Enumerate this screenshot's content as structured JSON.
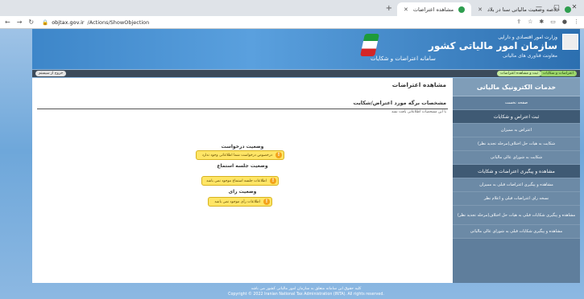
{
  "browser": {
    "tabs": [
      {
        "label": "خلاصه وضعیت مالیاتی سنا در بلاد",
        "active": false
      },
      {
        "label": "مشاهده اعتراضات",
        "active": true
      }
    ],
    "new_tab": "+",
    "url_host": "objtax.gov.ir",
    "url_path": "/Actions/ShowObjection"
  },
  "header": {
    "org_line1": "وزارت امور اقتصادی و دارایی",
    "org_name": "سازمان امور مالیاتی کشور",
    "org_line3": "معاونت فناوری های مالیاتی",
    "system_name": "سامانه اعتراضات و شکایات"
  },
  "navbar": {
    "btn_complaints": "اعتراضات و شکایات",
    "btn_view": "ثبت و مشاهده اعتراضات",
    "btn_logout": "خروج از سیستم"
  },
  "sidebar": {
    "brand": "خدمات الکترونیک مالیاتی",
    "items": [
      "صفحه نخست",
      "ثبت اعتراض و شکایات",
      "اعتراض به ممیزان",
      "شکایت به هیات حل اختلاف(مرحله تجدید نظر)",
      "شکایت به شورای عالی مالیاتی",
      "مشاهده و پیگیری اعتراضات و شکایات",
      "مشاهده و پیگیری اعتراضات قبلی به ممیزان",
      "نسخه رای اعتراضات قبلی و اعلام نظر",
      "مشاهده و پیگیری شکایات قبلی به هیات حل اختلاف(مرحله تجدید نظر)",
      "مشاهده و پیگیری شکایات قبلی به شورای عالی مالیاتی"
    ]
  },
  "main": {
    "page_title": "مشاهده اعتراضات",
    "section_title": "مشخصات برگه مورد اعتراض/شکایت",
    "note": "با این مشخصات اطلاعاتی یافت نشد",
    "request_status_title": "وضعیت درخواست",
    "request_status_msg": "درخصوص درخواست شما اطلاعاتی وجود ندارد",
    "hearing_status_title": "وضعیت جلسه استماع",
    "hearing_status_msg": "اطلاعات جلسه استماع موجود نمی باشد",
    "verdict_status_title": "وضعیت رای",
    "verdict_status_msg": "اطلاعات رأی موجود نمی باشد"
  },
  "footer": {
    "line1": "کلیه حقوق این سامانه متعلق به سازمان امور مالیاتی کشور می باشد",
    "line2": "Copyright © 2022 Iranian National Tax Administration (INTA). All rights reserved."
  }
}
